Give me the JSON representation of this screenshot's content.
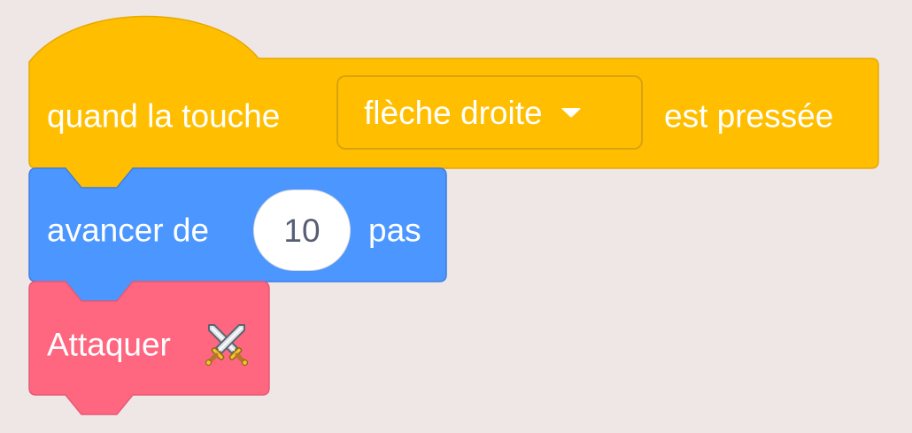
{
  "blocks": {
    "hat": {
      "text_before": "quand la touche",
      "dropdown_value": "flèche droite",
      "text_after": "est pressée",
      "color": "#ffbf00"
    },
    "motion": {
      "text_before": "avancer de",
      "value": "10",
      "text_after": "pas",
      "color": "#4c97ff"
    },
    "custom": {
      "label": "Attaquer",
      "icon": "crossed-swords-icon",
      "color": "#ff6680"
    }
  },
  "background_color": "#efe6e6"
}
